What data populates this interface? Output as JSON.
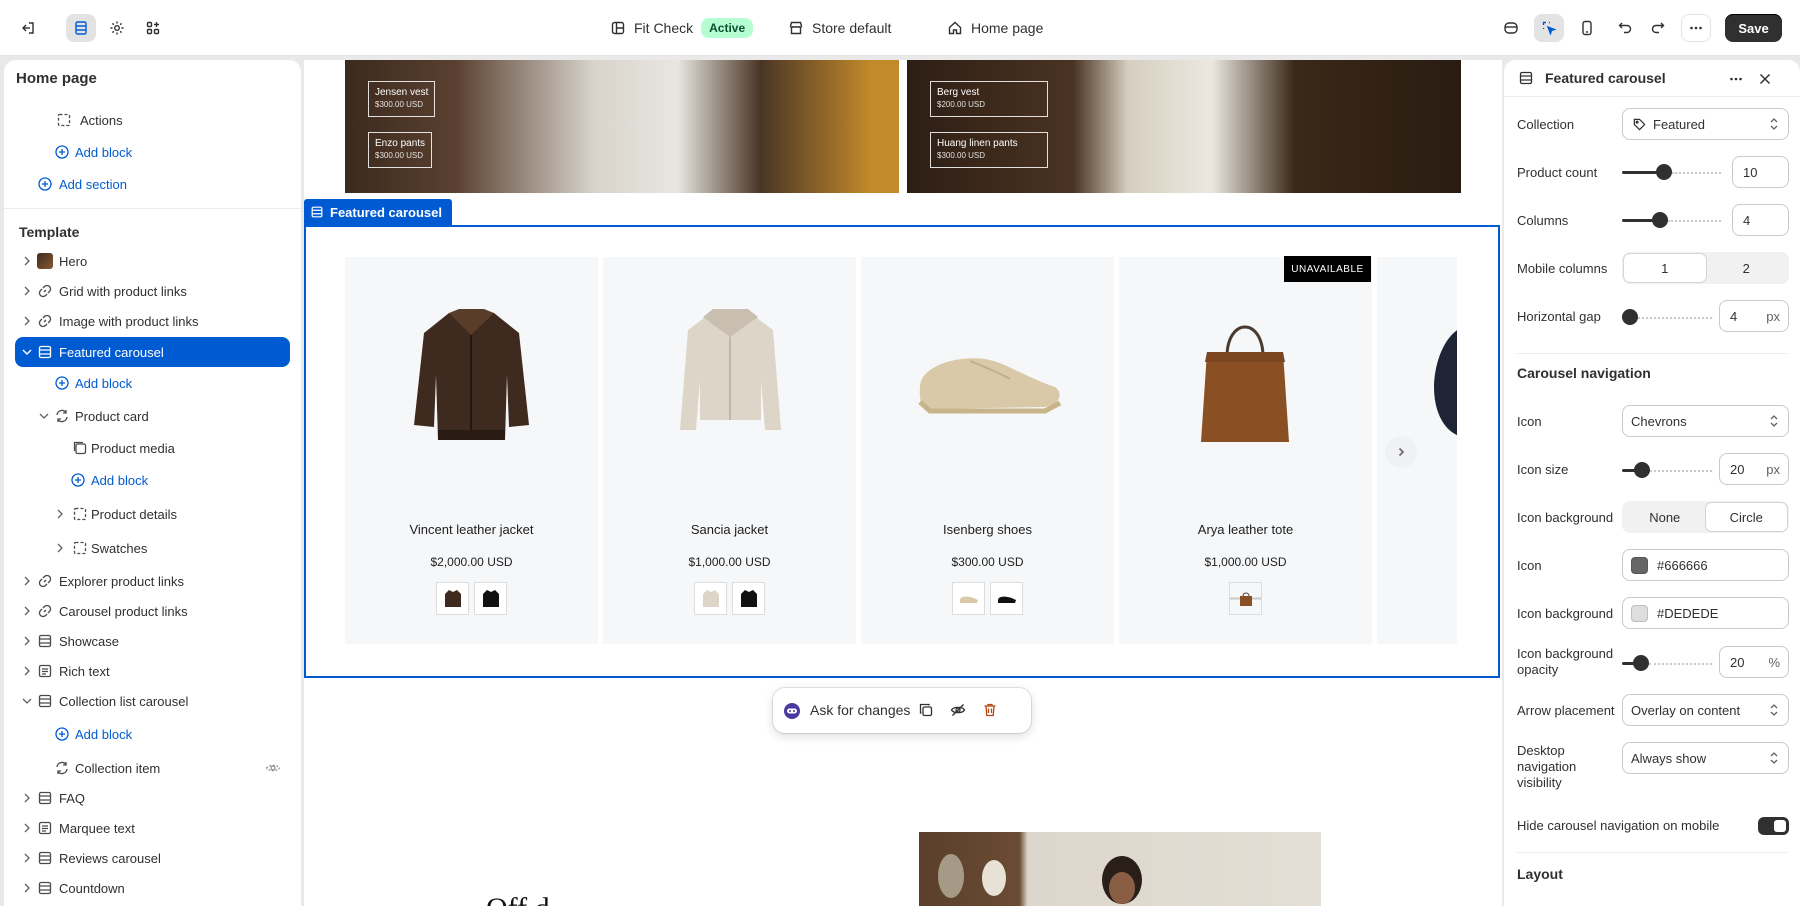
{
  "topbar": {
    "theme_name": "Fit Check",
    "theme_status": "Active",
    "store": "Store default",
    "page": "Home page",
    "save_label": "Save"
  },
  "left": {
    "title": "Home page",
    "actions": "Actions",
    "add_block": "Add block",
    "add_section": "Add section",
    "template_heading": "Template",
    "items": {
      "hero": "Hero",
      "grid": "Grid with product links",
      "image_links": "Image with product links",
      "featured": "Featured carousel",
      "product_card": "Product card",
      "product_media": "Product media",
      "product_details": "Product details",
      "swatches": "Swatches",
      "explorer": "Explorer product links",
      "carousel_links": "Carousel product links",
      "showcase": "Showcase",
      "rich_text": "Rich text",
      "collection_list": "Collection list carousel",
      "collection_item": "Collection item",
      "faq": "FAQ",
      "marquee": "Marquee text",
      "reviews": "Reviews carousel",
      "countdown": "Countdown"
    }
  },
  "canvas": {
    "hero_tags": [
      {
        "name": "Jensen vest",
        "price": "$300.00 USD"
      },
      {
        "name": "Enzo pants",
        "price": "$300.00 USD"
      },
      {
        "name": "Berg vest",
        "price": "$200.00 USD"
      },
      {
        "name": "Huang linen pants",
        "price": "$300.00 USD"
      }
    ],
    "section_label": "Featured carousel",
    "unavailable": "UNAVAILABLE",
    "products": [
      {
        "name": "Vincent leather jacket",
        "price": "$2,000.00 USD"
      },
      {
        "name": "Sancia jacket",
        "price": "$1,000.00 USD"
      },
      {
        "name": "Isenberg shoes",
        "price": "$300.00 USD"
      },
      {
        "name": "Arya leather tote",
        "price": "$1,000.00 USD"
      }
    ],
    "ask_label": "Ask for changes",
    "bottom_heading": "Off  d"
  },
  "settings": {
    "title": "Featured carousel",
    "collection_label": "Collection",
    "collection_value": "Featured",
    "product_count_label": "Product count",
    "product_count_value": "10",
    "columns_label": "Columns",
    "columns_value": "4",
    "mobile_columns_label": "Mobile columns",
    "mobile_columns_opt1": "1",
    "mobile_columns_opt2": "2",
    "hgap_label": "Horizontal gap",
    "hgap_value": "4",
    "px": "px",
    "pct": "%",
    "nav_section": "Carousel navigation",
    "icon_label": "Icon",
    "icon_value": "Chevrons",
    "icon_size_label": "Icon size",
    "icon_size_value": "20",
    "icon_bg_label": "Icon background",
    "icon_bg_opt1": "None",
    "icon_bg_opt2": "Circle",
    "icon_color_label": "Icon",
    "icon_color_value": "#666666",
    "icon_bg_color_label": "Icon background",
    "icon_bg_color_value": "#DEDEDE",
    "icon_bg_opacity_label": "Icon background opacity",
    "icon_bg_opacity_value": "20",
    "arrow_label": "Arrow placement",
    "arrow_value": "Overlay on content",
    "desktop_nav_label": "Desktop navigation visibility",
    "desktop_nav_value": "Always show",
    "hide_mobile_label": "Hide carousel navigation on mobile",
    "layout_section": "Layout"
  },
  "colors": {
    "accent": "#005bd3",
    "icon": "#666666",
    "icon_bg": "#DEDEDE"
  }
}
